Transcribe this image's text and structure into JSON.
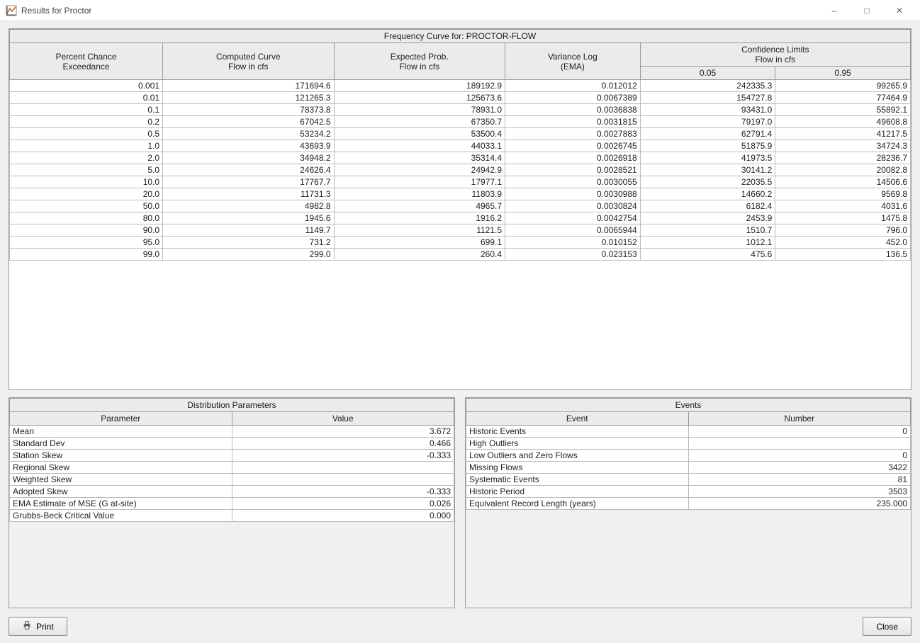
{
  "window": {
    "title": "Results for Proctor",
    "buttons": {
      "min": "–",
      "max": "□",
      "close": "✕"
    }
  },
  "frequency": {
    "caption": "Frequency Curve for: PROCTOR-FLOW",
    "headers": {
      "percent_chance": "Percent Chance",
      "exceedance": "Exceedance",
      "computed_curve": "Computed Curve",
      "flow_in_cfs": "Flow in cfs",
      "expected_prob": "Expected Prob.",
      "variance_log": "Variance Log",
      "ema": "(EMA)",
      "confidence_limits": "Confidence Limits",
      "cl005": "0.05",
      "cl095": "0.95"
    },
    "rows": [
      {
        "pct": "0.001",
        "comp": "171694.6",
        "exp": "189192.9",
        "var": "0.012012",
        "cl05": "242335.3",
        "cl95": "99265.9"
      },
      {
        "pct": "0.01",
        "comp": "121265.3",
        "exp": "125673.6",
        "var": "0.0067389",
        "cl05": "154727.8",
        "cl95": "77464.9"
      },
      {
        "pct": "0.1",
        "comp": "78373.8",
        "exp": "78931.0",
        "var": "0.0036838",
        "cl05": "93431.0",
        "cl95": "55892.1"
      },
      {
        "pct": "0.2",
        "comp": "67042.5",
        "exp": "67350.7",
        "var": "0.0031815",
        "cl05": "79197.0",
        "cl95": "49608.8"
      },
      {
        "pct": "0.5",
        "comp": "53234.2",
        "exp": "53500.4",
        "var": "0.0027883",
        "cl05": "62791.4",
        "cl95": "41217.5"
      },
      {
        "pct": "1.0",
        "comp": "43693.9",
        "exp": "44033.1",
        "var": "0.0026745",
        "cl05": "51875.9",
        "cl95": "34724.3"
      },
      {
        "pct": "2.0",
        "comp": "34948.2",
        "exp": "35314.4",
        "var": "0.0026918",
        "cl05": "41973.5",
        "cl95": "28236.7"
      },
      {
        "pct": "5.0",
        "comp": "24626.4",
        "exp": "24942.9",
        "var": "0.0028521",
        "cl05": "30141.2",
        "cl95": "20082.8"
      },
      {
        "pct": "10.0",
        "comp": "17767.7",
        "exp": "17977.1",
        "var": "0.0030055",
        "cl05": "22035.5",
        "cl95": "14506.6"
      },
      {
        "pct": "20.0",
        "comp": "11731.3",
        "exp": "11803.9",
        "var": "0.0030988",
        "cl05": "14660.2",
        "cl95": "9569.8"
      },
      {
        "pct": "50.0",
        "comp": "4982.8",
        "exp": "4965.7",
        "var": "0.0030824",
        "cl05": "6182.4",
        "cl95": "4031.6"
      },
      {
        "pct": "80.0",
        "comp": "1945.6",
        "exp": "1916.2",
        "var": "0.0042754",
        "cl05": "2453.9",
        "cl95": "1475.8"
      },
      {
        "pct": "90.0",
        "comp": "1149.7",
        "exp": "1121.5",
        "var": "0.0065944",
        "cl05": "1510.7",
        "cl95": "796.0"
      },
      {
        "pct": "95.0",
        "comp": "731.2",
        "exp": "699.1",
        "var": "0.010152",
        "cl05": "1012.1",
        "cl95": "452.0"
      },
      {
        "pct": "99.0",
        "comp": "299.0",
        "exp": "260.4",
        "var": "0.023153",
        "cl05": "475.6",
        "cl95": "136.5"
      }
    ]
  },
  "distribution": {
    "caption": "Distribution Parameters",
    "headers": {
      "parameter": "Parameter",
      "value": "Value"
    },
    "rows": [
      {
        "param": "Mean",
        "value": "3.672"
      },
      {
        "param": "Standard Dev",
        "value": "0.466"
      },
      {
        "param": "Station Skew",
        "value": "-0.333"
      },
      {
        "param": "Regional Skew",
        "value": ""
      },
      {
        "param": "Weighted Skew",
        "value": ""
      },
      {
        "param": "Adopted Skew",
        "value": "-0.333"
      },
      {
        "param": "EMA Estimate of MSE (G at-site)",
        "value": "0.026"
      },
      {
        "param": "Grubbs-Beck Critical Value",
        "value": "0.000"
      }
    ]
  },
  "events": {
    "caption": "Events",
    "headers": {
      "event": "Event",
      "number": "Number"
    },
    "rows": [
      {
        "event": "Historic Events",
        "number": "0"
      },
      {
        "event": "High Outliers",
        "number": ""
      },
      {
        "event": "Low Outliers and Zero Flows",
        "number": "0"
      },
      {
        "event": "Missing Flows",
        "number": "3422"
      },
      {
        "event": "Systematic Events",
        "number": "81"
      },
      {
        "event": "Historic Period",
        "number": "3503"
      },
      {
        "event": "Equivalent Record Length (years)",
        "number": "235.000"
      }
    ]
  },
  "footer": {
    "print": "Print",
    "close": "Close"
  }
}
